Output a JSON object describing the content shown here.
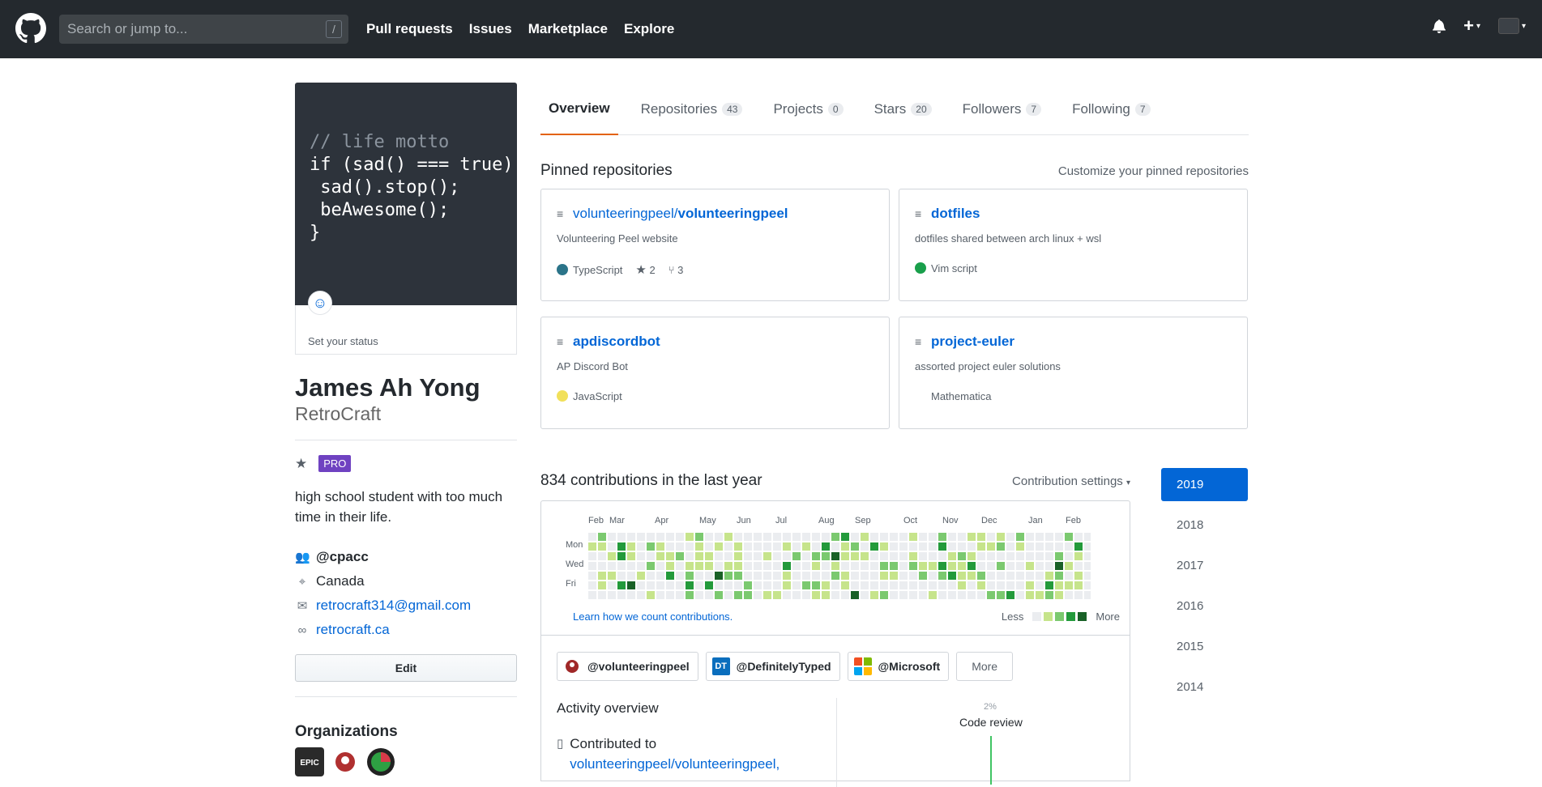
{
  "header": {
    "search_placeholder": "Search or jump to...",
    "search_shortcut": "/",
    "nav": [
      "Pull requests",
      "Issues",
      "Marketplace",
      "Explore"
    ]
  },
  "profile": {
    "motto_lines": [
      "// life motto",
      "if (sad() === true) {",
      " sad().stop();",
      " beAwesome();",
      "}"
    ],
    "status_text": "Set your status",
    "name": "James Ah Yong",
    "login": "RetroCraft",
    "pro_badge": "PRO",
    "bio": "high school student with too much time in their life.",
    "company": "@cpacc",
    "location": "Canada",
    "email": "retrocraft314@gmail.com",
    "website": "retrocraft.ca",
    "edit_label": "Edit",
    "organizations_title": "Organizations"
  },
  "tabs": [
    {
      "label": "Overview",
      "count": ""
    },
    {
      "label": "Repositories",
      "count": "43"
    },
    {
      "label": "Projects",
      "count": "0"
    },
    {
      "label": "Stars",
      "count": "20"
    },
    {
      "label": "Followers",
      "count": "7"
    },
    {
      "label": "Following",
      "count": "7"
    }
  ],
  "pinned": {
    "title": "Pinned repositories",
    "customize": "Customize your pinned repositories",
    "repos": [
      {
        "owner": "volunteeringpeel/",
        "name": "volunteeringpeel",
        "desc": "Volunteering Peel website",
        "lang": "TypeScript",
        "lang_color": "#2b7489",
        "stars": "2",
        "forks": "3"
      },
      {
        "owner": "",
        "name": "dotfiles",
        "desc": "dotfiles shared between arch linux + wsl",
        "lang": "Vim script",
        "lang_color": "#199f4b",
        "stars": "",
        "forks": ""
      },
      {
        "owner": "",
        "name": "apdiscordbot",
        "desc": "AP Discord Bot",
        "lang": "JavaScript",
        "lang_color": "#f1e05a",
        "stars": "",
        "forks": ""
      },
      {
        "owner": "",
        "name": "project-euler",
        "desc": "assorted project euler solutions",
        "lang": "Mathematica",
        "lang_color": "",
        "stars": "",
        "forks": ""
      }
    ]
  },
  "contributions": {
    "title": "834 contributions in the last year",
    "settings": "Contribution settings",
    "months": [
      "Feb",
      "Mar",
      "Apr",
      "May",
      "Jun",
      "Jul",
      "Aug",
      "Sep",
      "Oct",
      "Nov",
      "Dec",
      "Jan",
      "Feb"
    ],
    "days": [
      "Mon",
      "Wed",
      "Fri"
    ],
    "learn": "Learn how we count contributions.",
    "less": "Less",
    "more": "More",
    "colors": [
      "#ebedf0",
      "#c6e48b",
      "#7bc96f",
      "#239a3b",
      "#196127"
    ]
  },
  "activity": {
    "orgs": [
      "@volunteeringpeel",
      "@DefinitelyTyped",
      "@Microsoft"
    ],
    "dt_label": "DT",
    "more": "More",
    "title": "Activity overview",
    "contributed_prefix": "Contributed to",
    "contributed_repo": "volunteeringpeel/volunteeringpeel,",
    "review_pct": "2%",
    "review_label": "Code review"
  },
  "years": [
    "2019",
    "2018",
    "2017",
    "2016",
    "2015",
    "2014"
  ]
}
